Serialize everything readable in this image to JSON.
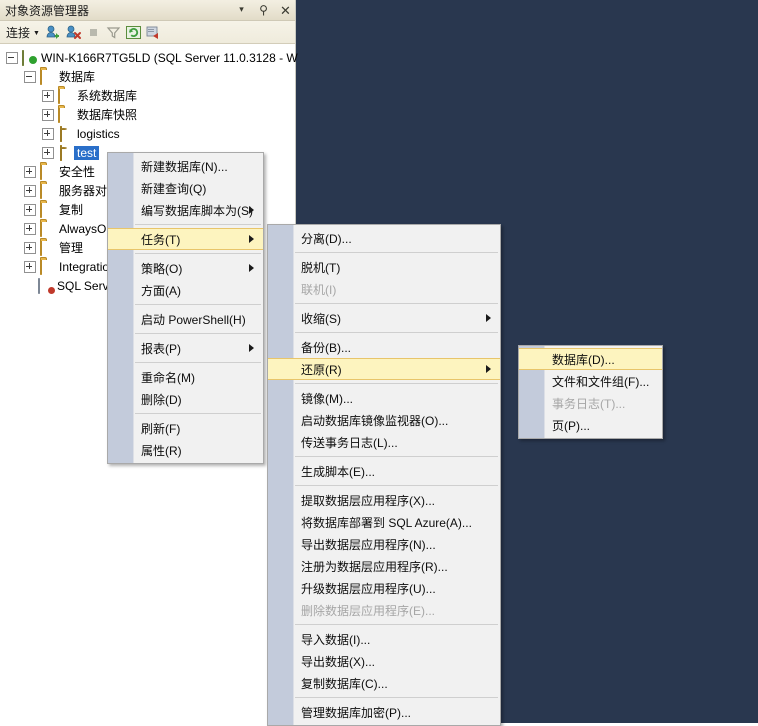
{
  "window": {
    "title": "对象资源管理器",
    "buttons": [
      {
        "name": "window-dropdown",
        "glyph": "▾"
      },
      {
        "name": "auto-hide-pin",
        "glyph": "⚲"
      },
      {
        "name": "close",
        "glyph": "✕"
      }
    ]
  },
  "toolbar": {
    "connect_label": "连接",
    "connect_caret": "▼",
    "icons": [
      "connect-object-explorer-icon",
      "disconnect-object-explorer-icon",
      "stop-icon",
      "filter-icon",
      "refresh-icon",
      "sync-icon"
    ]
  },
  "tree": {
    "nodes": [
      {
        "label": "WIN-K166R7TG5LD (SQL Server 11.0.3128 - W",
        "icon": "server-icon",
        "indent": 0,
        "state": "expanded",
        "selected": false
      },
      {
        "label": "数据库",
        "icon": "folder-icon",
        "indent": 1,
        "state": "expanded",
        "selected": false
      },
      {
        "label": "系统数据库",
        "icon": "folder-icon",
        "indent": 2,
        "state": "collapsed",
        "selected": false
      },
      {
        "label": "数据库快照",
        "icon": "folder-icon",
        "indent": 2,
        "state": "collapsed",
        "selected": false
      },
      {
        "label": "logistics",
        "icon": "database-icon",
        "indent": 2,
        "state": "collapsed",
        "selected": false
      },
      {
        "label": "test",
        "icon": "database-icon",
        "indent": 2,
        "state": "collapsed",
        "selected": true
      },
      {
        "label": "安全性",
        "icon": "folder-icon",
        "indent": 1,
        "state": "collapsed",
        "selected": false
      },
      {
        "label": "服务器对象",
        "icon": "folder-icon",
        "indent": 1,
        "state": "collapsed",
        "selected": false
      },
      {
        "label": "复制",
        "icon": "folder-icon",
        "indent": 1,
        "state": "collapsed",
        "selected": false
      },
      {
        "label": "AlwaysOn 高可用性",
        "icon": "folder-icon",
        "indent": 1,
        "state": "collapsed",
        "selected": false
      },
      {
        "label": "管理",
        "icon": "folder-icon",
        "indent": 1,
        "state": "collapsed",
        "selected": false
      },
      {
        "label": "Integration Services 目录",
        "icon": "folder-icon",
        "indent": 1,
        "state": "collapsed",
        "selected": false
      },
      {
        "label": "SQL Server 代理",
        "icon": "sql-agent-icon",
        "indent": 1,
        "state": "leaf",
        "selected": false
      }
    ]
  },
  "context_menu_database": {
    "items": [
      {
        "label": "新建数据库(N)...",
        "submenu": false,
        "disabled": false,
        "highlighted": false
      },
      {
        "label": "新建查询(Q)",
        "submenu": false,
        "disabled": false,
        "highlighted": false
      },
      {
        "label": "编写数据库脚本为(S)",
        "submenu": true,
        "disabled": false,
        "highlighted": false
      },
      {
        "separator": true
      },
      {
        "label": "任务(T)",
        "submenu": true,
        "disabled": false,
        "highlighted": true
      },
      {
        "separator": true
      },
      {
        "label": "策略(O)",
        "submenu": true,
        "disabled": false,
        "highlighted": false
      },
      {
        "label": "方面(A)",
        "submenu": false,
        "disabled": false,
        "highlighted": false
      },
      {
        "separator": true
      },
      {
        "label": "启动 PowerShell(H)",
        "submenu": false,
        "disabled": false,
        "highlighted": false
      },
      {
        "separator": true
      },
      {
        "label": "报表(P)",
        "submenu": true,
        "disabled": false,
        "highlighted": false
      },
      {
        "separator": true
      },
      {
        "label": "重命名(M)",
        "submenu": false,
        "disabled": false,
        "highlighted": false
      },
      {
        "label": "删除(D)",
        "submenu": false,
        "disabled": false,
        "highlighted": false
      },
      {
        "separator": true
      },
      {
        "label": "刷新(F)",
        "submenu": false,
        "disabled": false,
        "highlighted": false
      },
      {
        "label": "属性(R)",
        "submenu": false,
        "disabled": false,
        "highlighted": false
      }
    ]
  },
  "context_menu_tasks": {
    "items": [
      {
        "label": "分离(D)...",
        "submenu": false,
        "disabled": false,
        "highlighted": false
      },
      {
        "separator": true
      },
      {
        "label": "脱机(T)",
        "submenu": false,
        "disabled": false,
        "highlighted": false
      },
      {
        "label": "联机(I)",
        "submenu": false,
        "disabled": true,
        "highlighted": false
      },
      {
        "separator": true
      },
      {
        "label": "收缩(S)",
        "submenu": true,
        "disabled": false,
        "highlighted": false
      },
      {
        "separator": true
      },
      {
        "label": "备份(B)...",
        "submenu": false,
        "disabled": false,
        "highlighted": false
      },
      {
        "label": "还原(R)",
        "submenu": true,
        "disabled": false,
        "highlighted": true
      },
      {
        "separator": true
      },
      {
        "label": "镜像(M)...",
        "submenu": false,
        "disabled": false,
        "highlighted": false
      },
      {
        "label": "启动数据库镜像监视器(O)...",
        "submenu": false,
        "disabled": false,
        "highlighted": false
      },
      {
        "label": "传送事务日志(L)...",
        "submenu": false,
        "disabled": false,
        "highlighted": false
      },
      {
        "separator": true
      },
      {
        "label": "生成脚本(E)...",
        "submenu": false,
        "disabled": false,
        "highlighted": false
      },
      {
        "separator": true
      },
      {
        "label": "提取数据层应用程序(X)...",
        "submenu": false,
        "disabled": false,
        "highlighted": false
      },
      {
        "label": "将数据库部署到 SQL Azure(A)...",
        "submenu": false,
        "disabled": false,
        "highlighted": false
      },
      {
        "label": "导出数据层应用程序(N)...",
        "submenu": false,
        "disabled": false,
        "highlighted": false
      },
      {
        "label": "注册为数据层应用程序(R)...",
        "submenu": false,
        "disabled": false,
        "highlighted": false
      },
      {
        "label": "升级数据层应用程序(U)...",
        "submenu": false,
        "disabled": false,
        "highlighted": false
      },
      {
        "label": "删除数据层应用程序(E)...",
        "submenu": false,
        "disabled": true,
        "highlighted": false
      },
      {
        "separator": true
      },
      {
        "label": "导入数据(I)...",
        "submenu": false,
        "disabled": false,
        "highlighted": false
      },
      {
        "label": "导出数据(X)...",
        "submenu": false,
        "disabled": false,
        "highlighted": false
      },
      {
        "label": "复制数据库(C)...",
        "submenu": false,
        "disabled": false,
        "highlighted": false
      },
      {
        "separator": true
      },
      {
        "label": "管理数据库加密(P)...",
        "submenu": false,
        "disabled": false,
        "highlighted": false
      }
    ]
  },
  "context_menu_restore": {
    "items": [
      {
        "label": "数据库(D)...",
        "submenu": false,
        "disabled": false,
        "highlighted": true
      },
      {
        "label": "文件和文件组(F)...",
        "submenu": false,
        "disabled": false,
        "highlighted": false
      },
      {
        "label": "事务日志(T)...",
        "submenu": false,
        "disabled": true,
        "highlighted": false
      },
      {
        "label": "页(P)...",
        "submenu": false,
        "disabled": false,
        "highlighted": false
      }
    ]
  },
  "colors": {
    "desktop": "#29374f",
    "menu_bg": "#f1f1f1",
    "menu_gutter": "#c3cbdb",
    "highlight": "#fdf4bf",
    "highlight_border": "#e8c56a",
    "selection": "#2a6fc9",
    "titlebar": "#eae5d4"
  }
}
